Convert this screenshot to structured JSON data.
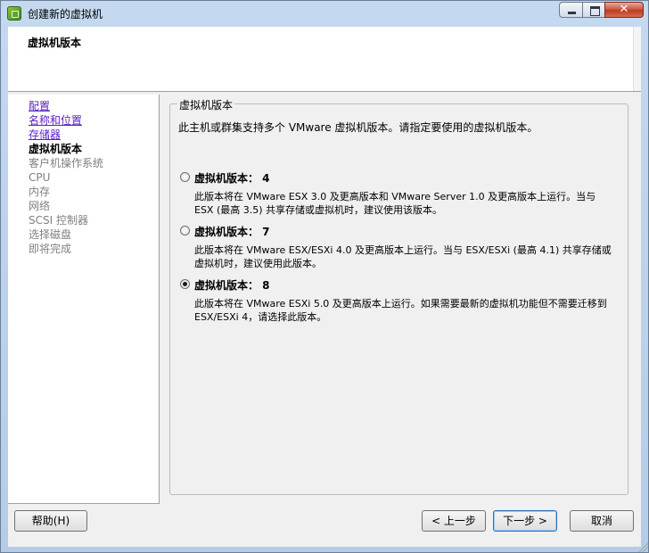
{
  "window": {
    "title": "创建新的虚拟机",
    "close_glyph": "✕"
  },
  "header": {
    "title": "虚拟机版本"
  },
  "nav": {
    "items": [
      {
        "label": "配置",
        "state": "link"
      },
      {
        "label": "名称和位置",
        "state": "link"
      },
      {
        "label": "存储器",
        "state": "link"
      },
      {
        "label": "虚拟机版本",
        "state": "current"
      },
      {
        "label": "客户机操作系统",
        "state": "disabled"
      },
      {
        "label": "CPU",
        "state": "disabled"
      },
      {
        "label": "内存",
        "state": "disabled"
      },
      {
        "label": "网络",
        "state": "disabled"
      },
      {
        "label": "SCSI 控制器",
        "state": "disabled"
      },
      {
        "label": "选择磁盘",
        "state": "disabled"
      },
      {
        "label": "即将完成",
        "state": "disabled"
      }
    ]
  },
  "content": {
    "group_title": "虚拟机版本",
    "intro": "此主机或群集支持多个 VMware 虚拟机版本。请指定要使用的虚拟机版本。",
    "options": [
      {
        "label": "虚拟机版本： 4",
        "checked": false,
        "description": "此版本将在 VMware ESX 3.0 及更高版本和 VMware Server 1.0 及更高版本上运行。当与 ESX (最高 3.5) 共享存储或虚拟机时，建议使用该版本。"
      },
      {
        "label": "虚拟机版本： 7",
        "checked": false,
        "description": "此版本将在 VMware ESX/ESXi 4.0 及更高版本上运行。当与 ESX/ESXi (最高 4.1) 共享存储或虚拟机时，建议使用此版本。"
      },
      {
        "label": "虚拟机版本： 8",
        "checked": true,
        "description": "此版本将在 VMware ESXi 5.0 及更高版本上运行。如果需要最新的虚拟机功能但不需要迁移到 ESX/ESXi 4，请选择此版本。"
      }
    ]
  },
  "buttons": {
    "help": "帮助(H)",
    "back": "< 上一步",
    "next": "下一步 >",
    "cancel": "取消"
  }
}
